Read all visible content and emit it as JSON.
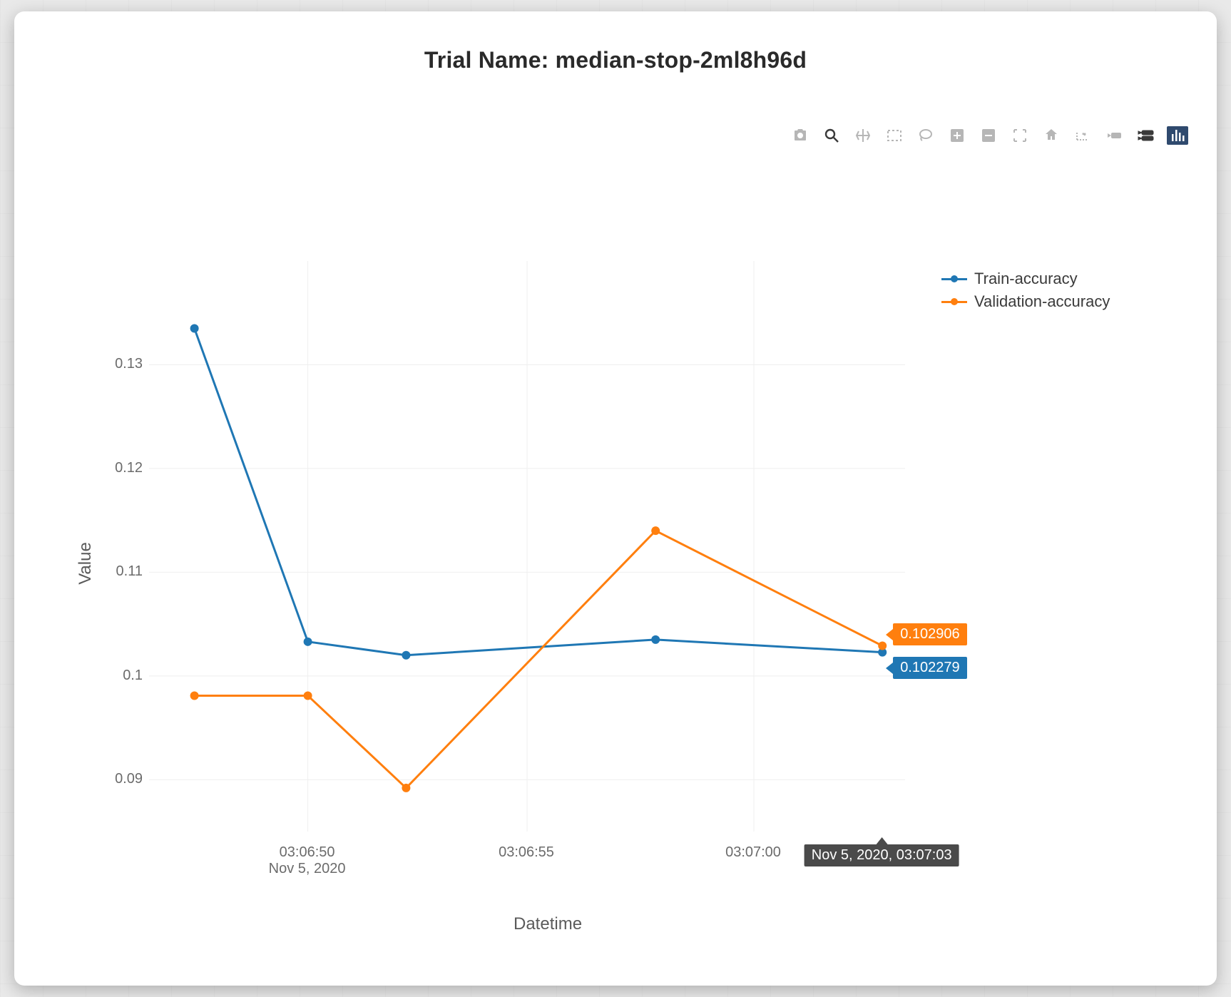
{
  "title": "Trial Name: median-stop-2ml8h96d",
  "axes": {
    "y_label": "Value",
    "x_label": "Datetime",
    "y_ticks": [
      "0.09",
      "0.1",
      "0.11",
      "0.12",
      "0.13"
    ],
    "x_ticks": [
      {
        "time": "03:06:50",
        "date": "Nov 5, 2020"
      },
      {
        "time": "03:06:55",
        "date": ""
      },
      {
        "time": "03:07:00",
        "date": ""
      }
    ]
  },
  "legend": {
    "train": "Train-accuracy",
    "validation": "Validation-accuracy"
  },
  "hover": {
    "x_label": "Nov 5, 2020, 03:07:03",
    "orange_value": "0.102906",
    "blue_value": "0.102279"
  },
  "colors": {
    "train": "#1f77b4",
    "validation": "#ff7f0e",
    "grid": "#efefef",
    "tooltip_bg": "#4a4a4a"
  },
  "chart_data": {
    "type": "line",
    "title": "Trial Name: median-stop-2ml8h96d",
    "xlabel": "Datetime",
    "ylabel": "Value",
    "ylim": [
      0.085,
      0.14
    ],
    "x_ticks": [
      "03:06:50",
      "03:06:55",
      "03:07:00"
    ],
    "x_date": "Nov 5, 2020",
    "x": [
      "03:06:47",
      "03:06:50",
      "03:06:52",
      "03:06:58",
      "03:07:03"
    ],
    "series": [
      {
        "name": "Train-accuracy",
        "color": "#1f77b4",
        "values": [
          0.1335,
          0.1033,
          0.102,
          0.1035,
          0.102279
        ]
      },
      {
        "name": "Validation-accuracy",
        "color": "#ff7f0e",
        "values": [
          0.0981,
          0.0981,
          0.0892,
          0.114,
          0.102906
        ]
      }
    ],
    "hover_point": {
      "x": "03:07:03",
      "x_full": "Nov 5, 2020, 03:07:03",
      "values": {
        "Train-accuracy": 0.102279,
        "Validation-accuracy": 0.102906
      }
    }
  }
}
